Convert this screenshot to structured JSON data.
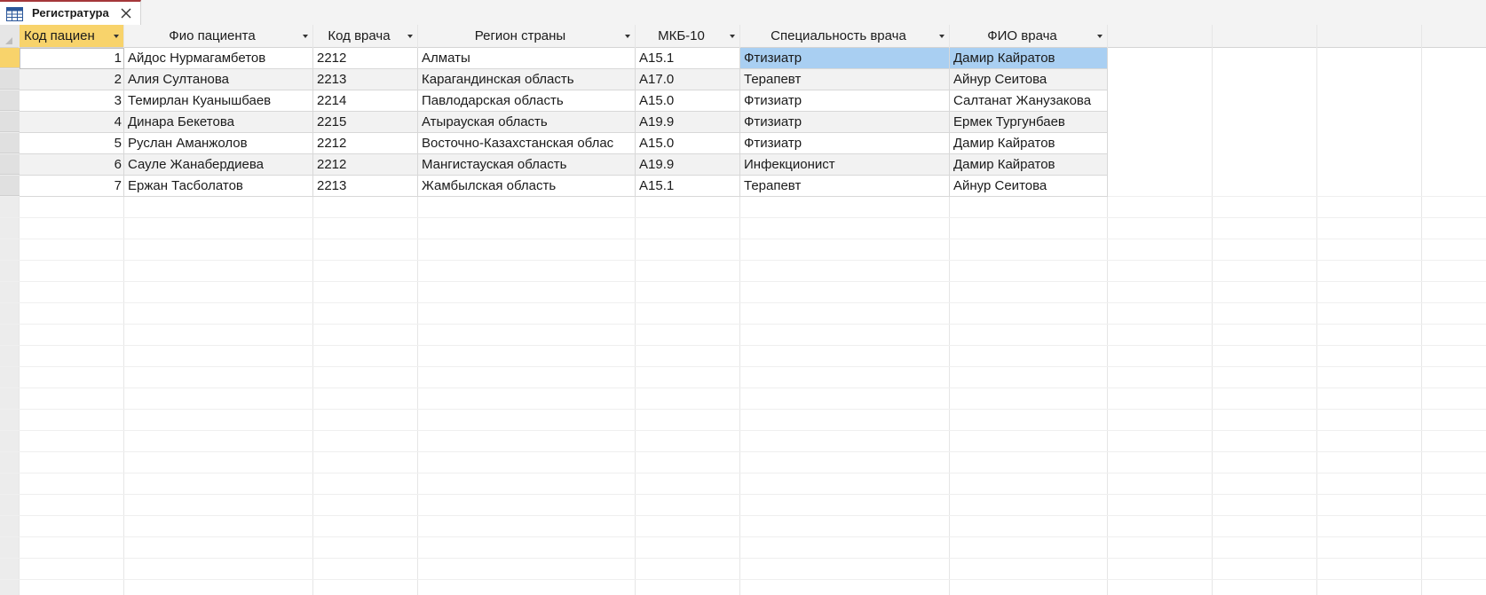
{
  "tab": {
    "title": "Регистратура",
    "icon": "table-icon",
    "close_icon": "close-icon"
  },
  "columns": [
    {
      "key": "id",
      "label": "Код пациен"
    },
    {
      "key": "patient",
      "label": "Фио пациента"
    },
    {
      "key": "doctor_code",
      "label": "Код врача"
    },
    {
      "key": "region",
      "label": "Регион страны"
    },
    {
      "key": "icd",
      "label": "МКБ-10"
    },
    {
      "key": "specialty",
      "label": "Специальность врача"
    },
    {
      "key": "doctor_name",
      "label": "ФИО врача"
    }
  ],
  "rows": [
    {
      "id": "1",
      "patient": "Айдос Нурмагамбетов",
      "doctor_code": "2212",
      "region": "Алматы",
      "icd": "A15.1",
      "specialty": "Фтизиатр",
      "doctor_name": "Дамир Кайратов"
    },
    {
      "id": "2",
      "patient": "Алия Султанова",
      "doctor_code": "2213",
      "region": "Карагандинская область",
      "icd": "A17.0",
      "specialty": "Терапевт",
      "doctor_name": "Айнур Сеитова"
    },
    {
      "id": "3",
      "patient": "Темирлан Куанышбаев",
      "doctor_code": "2214",
      "region": "Павлодарская область",
      "icd": "A15.0",
      "specialty": "Фтизиатр",
      "doctor_name": "Салтанат Жанузакова"
    },
    {
      "id": "4",
      "patient": "Динара Бекетова",
      "doctor_code": "2215",
      "region": "Атырауская область",
      "icd": "A19.9",
      "specialty": "Фтизиатр",
      "doctor_name": "Ермек Тургунбаев"
    },
    {
      "id": "5",
      "patient": "Руслан Аманжолов",
      "doctor_code": "2212",
      "region": "Восточно-Казахстанская облас",
      "icd": "A15.0",
      "specialty": "Фтизиатр",
      "doctor_name": "Дамир Кайратов"
    },
    {
      "id": "6",
      "patient": "Сауле Жанабердиева",
      "doctor_code": "2212",
      "region": "Мангистауская область",
      "icd": "A19.9",
      "specialty": "Инфекционист",
      "doctor_name": "Дамир Кайратов"
    },
    {
      "id": "7",
      "patient": "Ержан Тасболатов",
      "doctor_code": "2213",
      "region": "Жамбылская область",
      "icd": "A15.1",
      "specialty": "Терапевт",
      "doctor_name": "Айнур Сеитова"
    }
  ],
  "colors": {
    "accent_tab": "#a4373a",
    "selected_column_header": "#f8d36b",
    "highlighted_cells": "#a9cff2"
  }
}
